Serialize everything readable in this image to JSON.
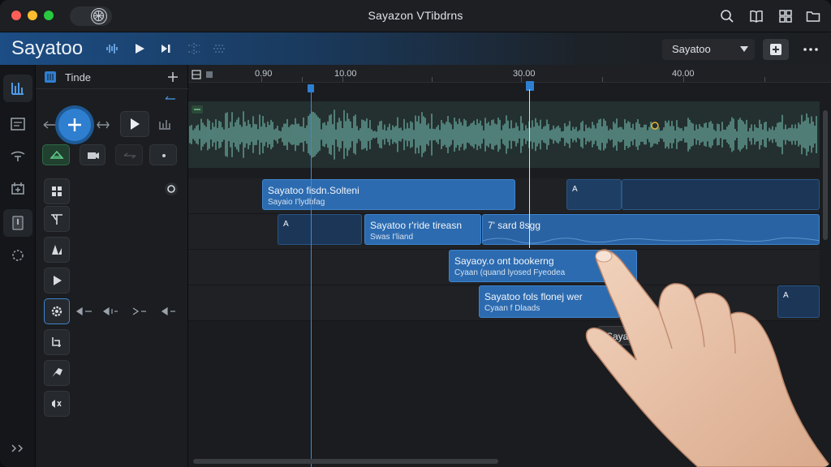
{
  "window": {
    "title": "Sayazon VTibdrns",
    "toolbar_icons": [
      "search-icon",
      "book-icon",
      "grid-icon",
      "folder-icon"
    ]
  },
  "header": {
    "brand": "Sayatoo",
    "dropdown_value": "Sayatoo",
    "colors": {
      "accent": "#2f7fd1",
      "header_start": "#1c4d84"
    }
  },
  "panel": {
    "title": "Tinde"
  },
  "ruler": {
    "labels": [
      "0.90",
      "10.00",
      "30.00",
      "40.00"
    ]
  },
  "clips": {
    "c1": {
      "title": "Sayatoo fisdn.Solteni",
      "sub": "Sayaio I'lydbfag"
    },
    "c2": {
      "title": "A"
    },
    "c3": {
      "title": "A"
    },
    "c4": {
      "title": "Sayatoo r'ride tireasn",
      "sub": "Swas I'liand"
    },
    "c5": {
      "title": "7' sard 8sgg"
    },
    "c6": {
      "title": "Sayaoy.o ont bookerng",
      "sub": "Cyaan (quand lyosed Fyeodea"
    },
    "c7": {
      "title": "Sayatoo fols flonej wer",
      "sub": "Cyaan f Dlaads"
    },
    "c8": {
      "title": "A"
    },
    "c9": {
      "title": "ti di'S"
    }
  },
  "tooltip": "Sayatoo"
}
